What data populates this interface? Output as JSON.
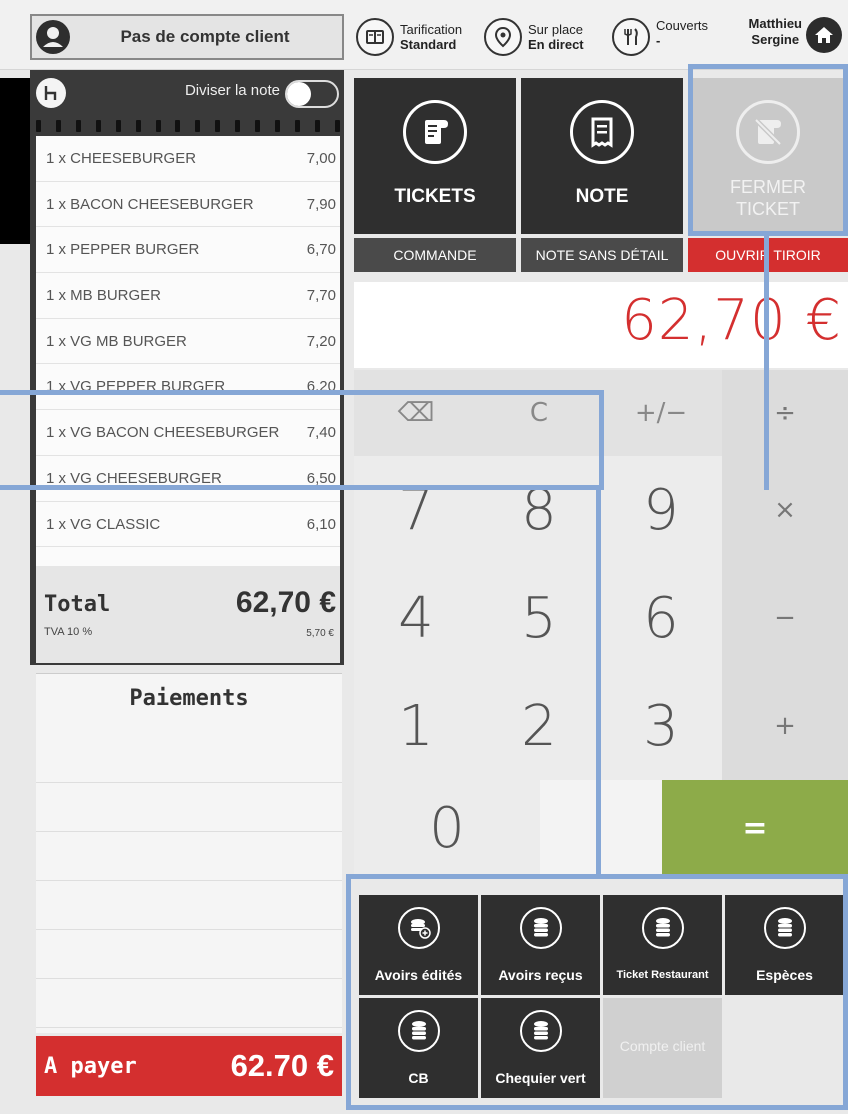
{
  "topbar": {
    "client_label": "Pas de compte client",
    "tarification_label": "Tarification",
    "tarification_value": "Standard",
    "service_label": "Sur place",
    "service_value": "En direct",
    "couverts_label": "Couverts",
    "couverts_value": "-",
    "user_first": "Matthieu",
    "user_last": "Sergine"
  },
  "receipt": {
    "split_label": "Diviser la note",
    "items": [
      {
        "text": "1 x CHEESEBURGER",
        "price": "7,00"
      },
      {
        "text": "1 x BACON CHEESEBURGER",
        "price": "7,90"
      },
      {
        "text": "1 x PEPPER BURGER",
        "price": "6,70"
      },
      {
        "text": "1 x MB BURGER",
        "price": "7,70"
      },
      {
        "text": "1 x VG MB BURGER",
        "price": "7,20"
      },
      {
        "text": "1 x VG PEPPER BURGER",
        "price": "6,20"
      },
      {
        "text": "1 x VG BACON CHEESEBURGER",
        "price": "7,40"
      },
      {
        "text": "1 x VG CHEESEBURGER",
        "price": "6,50"
      },
      {
        "text": "1 x VG CLASSIC",
        "price": "6,10"
      }
    ],
    "total_label": "Total",
    "total_value": "62,70 €",
    "tva_label": "TVA 10 %",
    "tva_value": "5,70 €"
  },
  "payments": {
    "title": "Paiements",
    "apayer_label": "A payer",
    "apayer_value": "62.70 €"
  },
  "actions": {
    "tickets": "TICKETS",
    "note": "NOTE",
    "fermer_line1": "FERMER",
    "fermer_line2": "TICKET",
    "commande": "COMMANDE",
    "note_sans_detail": "NOTE SANS DÉTAIL",
    "ouvrir_tiroir": "OUVRIR TIROIR"
  },
  "display": {
    "value": "62,70 €"
  },
  "keypad": {
    "backspace": "⌫",
    "clear": "C",
    "plusminus": "+/−",
    "divide": "÷",
    "k7": "7",
    "k8": "8",
    "k9": "9",
    "multiply": "×",
    "k4": "4",
    "k5": "5",
    "k6": "6",
    "minus": "−",
    "k1": "1",
    "k2": "2",
    "k3": "3",
    "plus": "+",
    "k0": "0",
    "equals": "="
  },
  "payment_methods": {
    "avoirs_edites": "Avoirs édités",
    "avoirs_recus": "Avoirs reçus",
    "ticket_restaurant": "Ticket Restaurant",
    "especes": "Espèces",
    "cb": "CB",
    "chequier_vert": "Chequier vert",
    "compte_client": "Compte client"
  },
  "colors": {
    "accent_red": "#d42f2f",
    "equals_green": "#8dab49",
    "tile_dark": "#2f2f2f",
    "highlight_blue": "#86a7d6"
  }
}
